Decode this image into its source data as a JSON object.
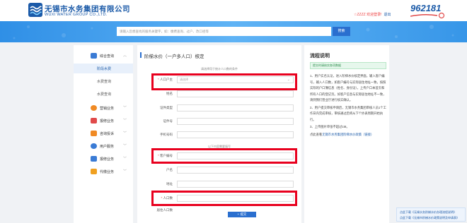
{
  "header": {
    "logo_cn": "无锡市水务集团有限公司",
    "logo_en": "WUXI WATER GROUP CO.,LTD.",
    "user_text": "☆ZZZZ 欢迎登录!",
    "logout_label": "退出",
    "hotline": "962181"
  },
  "search": {
    "placeholder": "请输入您想查找的服务关键字，如：缴费查询、过户、改口径等",
    "button_label": "搜索"
  },
  "sidebar": {
    "items": [
      {
        "label": "综合查询",
        "icon": "search-doc-icon",
        "color": "#3a7bd5",
        "expanded": true
      },
      {
        "label": "营销业务",
        "icon": "water-drop-icon",
        "color": "#f08a24"
      },
      {
        "label": "报修业务",
        "icon": "wrench-icon",
        "color": "#e04a4a"
      },
      {
        "label": "咨询投诉",
        "icon": "chat-icon",
        "color": "#f08a24"
      },
      {
        "label": "用户服务",
        "icon": "user-icon",
        "color": "#3a7bd5"
      },
      {
        "label": "报修业务",
        "icon": "tool-icon",
        "color": "#3a7bd5"
      },
      {
        "label": "代缴业务",
        "icon": "bank-icon",
        "color": "#f0a020"
      }
    ],
    "subitems": [
      {
        "label": "阶段水费",
        "active": true
      },
      {
        "label": "水费查询",
        "active": false
      },
      {
        "label": "水费查询",
        "active": false
      }
    ]
  },
  "form": {
    "title": "阶梯水价（一户多人口）核定",
    "hint_top": "请选择用于统计人口数的条件",
    "hint_mid": "以下内容需要填写",
    "fields": [
      {
        "label": "人口户主",
        "value": "请选择",
        "required": true,
        "type": "select"
      },
      {
        "label": "姓名",
        "value": ""
      },
      {
        "label": "证件类型",
        "value": ""
      },
      {
        "label": "证件号",
        "value": ""
      },
      {
        "label": "手机号码",
        "value": ""
      },
      {
        "label": "客户编号",
        "value": "",
        "required": true
      },
      {
        "label": "户名",
        "value": ""
      },
      {
        "label": "地址",
        "value": ""
      },
      {
        "label": "人口数",
        "value": "",
        "required": true
      },
      {
        "label": "居住人口数",
        "value": ""
      }
    ],
    "submit_label": "提交"
  },
  "process": {
    "title": "流程说明",
    "tag": "提交时请核实各项数据",
    "paragraphs": [
      "1、用户实名认证，进入阶梯水价核定界面，输入客户编号，输入人口数，如客户编号与实际居住地址一致，按照实际的户口簿信息（姓名、身份证），上传户口本首页和所有人口的登记页。如客户信息与实际居住地址不一致，请到我们营业厅进行核实确认。",
      "2、用户提交审核申请后，无锡市水务集团审核人员1个工作日内完成审核，审核通过后将从下个抄表周期开始执行。",
      "3、上传图片单张不超过1M。"
    ],
    "link_prefix": "点此查看",
    "link_text": "无锡市水务集团阶梯水价政策（链接）"
  },
  "downloads": {
    "line1": "点此下载《无锡水务阶梯水价办理流程说明》",
    "line2": "点此下载《无锡市阶梯水价政策说明及申请表》"
  }
}
